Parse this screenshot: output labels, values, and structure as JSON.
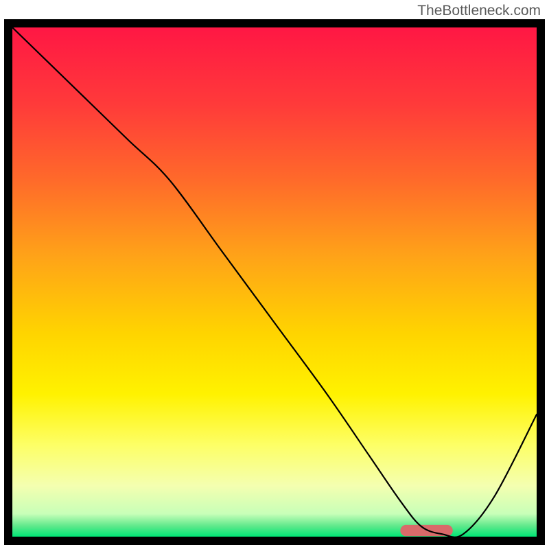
{
  "watermark": "TheBottleneck.com",
  "chart_data": {
    "type": "line",
    "title": "",
    "xlabel": "",
    "ylabel": "",
    "xlim": [
      0,
      100
    ],
    "ylim": [
      0,
      100
    ],
    "axes_visible": false,
    "grid": false,
    "background_gradient": {
      "stops": [
        {
          "offset": 0.0,
          "color": "#ff1744"
        },
        {
          "offset": 0.15,
          "color": "#ff3a3a"
        },
        {
          "offset": 0.3,
          "color": "#ff6a2a"
        },
        {
          "offset": 0.45,
          "color": "#ffa318"
        },
        {
          "offset": 0.6,
          "color": "#ffd400"
        },
        {
          "offset": 0.72,
          "color": "#fff200"
        },
        {
          "offset": 0.82,
          "color": "#fdff66"
        },
        {
          "offset": 0.9,
          "color": "#f4ffb0"
        },
        {
          "offset": 0.955,
          "color": "#c8ffb8"
        },
        {
          "offset": 0.98,
          "color": "#5be88a"
        },
        {
          "offset": 1.0,
          "color": "#00e676"
        }
      ]
    },
    "series": [
      {
        "name": "curve",
        "stroke": "#000000",
        "stroke_width": 2.2,
        "x": [
          0,
          12,
          22,
          30,
          40,
          50,
          60,
          68,
          74,
          78,
          82,
          86,
          92,
          100
        ],
        "y": [
          100,
          88,
          78,
          70,
          56,
          42,
          28,
          16,
          7,
          2,
          0.5,
          0.5,
          8,
          24
        ]
      }
    ],
    "markers": [
      {
        "name": "bottleneck-marker",
        "shape": "rounded-rect",
        "x_center": 79,
        "y_center": 1.2,
        "width": 10,
        "height": 2.2,
        "fill": "#d96a6a"
      }
    ],
    "frame": {
      "stroke": "#000000",
      "stroke_width": 12
    }
  }
}
